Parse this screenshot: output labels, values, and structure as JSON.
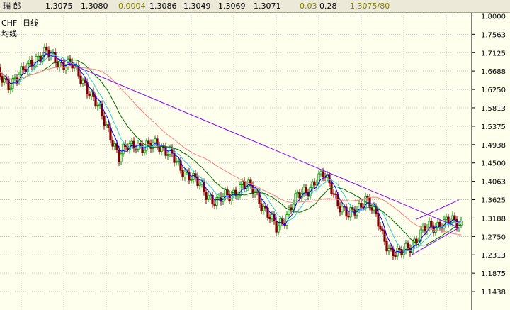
{
  "header": {
    "symbol": "瑞 郎",
    "open": "1.3075",
    "ask": "1.3080",
    "spread": "0.0004",
    "high": "1.3086",
    "low": "1.3049",
    "prev": "1.3069",
    "last": "1.3071",
    "change": "0.03",
    "change_pct": "0.28",
    "bid_ask": "1.3075/80"
  },
  "chart_labels": {
    "instrument": "CHF",
    "period": "日线",
    "indicator": "均线"
  },
  "colors": {
    "background": "#ffffee",
    "grid": "#c8c8c8",
    "candle_up": "#009000",
    "candle_down": "#800000",
    "trendline": "#8000ff",
    "ma_short": "#0000ff",
    "ma_mid": "#33cccc",
    "ma_long": "#006600",
    "ma_xlong": "#ff8080"
  },
  "chart_data": {
    "type": "candlestick",
    "ylim": [
      1.1,
      1.8075
    ],
    "yticks": [
      "1.8000",
      "1.7563",
      "1.7125",
      "1.6688",
      "1.6250",
      "1.5813",
      "1.5375",
      "1.4938",
      "1.4500",
      "1.4063",
      "1.3625",
      "1.3188",
      "1.2750",
      "1.2313",
      "1.1875",
      "1.1438"
    ],
    "grid": true,
    "close_path": [
      [
        0,
        1.66
      ],
      [
        6,
        1.64
      ],
      [
        12,
        1.66
      ],
      [
        18,
        1.7
      ],
      [
        24,
        1.71
      ],
      [
        30,
        1.69
      ],
      [
        36,
        1.68
      ],
      [
        42,
        1.64
      ],
      [
        48,
        1.58
      ],
      [
        54,
        1.52
      ],
      [
        58,
        1.46
      ],
      [
        62,
        1.49
      ],
      [
        66,
        1.5
      ],
      [
        70,
        1.48
      ],
      [
        76,
        1.5
      ],
      [
        82,
        1.47
      ],
      [
        86,
        1.44
      ],
      [
        92,
        1.42
      ],
      [
        98,
        1.38
      ],
      [
        104,
        1.36
      ],
      [
        110,
        1.37
      ],
      [
        116,
        1.4
      ],
      [
        122,
        1.38
      ],
      [
        128,
        1.33
      ],
      [
        132,
        1.29
      ],
      [
        136,
        1.32
      ],
      [
        140,
        1.36
      ],
      [
        146,
        1.38
      ],
      [
        150,
        1.41
      ],
      [
        154,
        1.42
      ],
      [
        158,
        1.39
      ],
      [
        162,
        1.35
      ],
      [
        166,
        1.32
      ],
      [
        170,
        1.34
      ],
      [
        174,
        1.37
      ],
      [
        178,
        1.33
      ],
      [
        182,
        1.28
      ],
      [
        186,
        1.24
      ],
      [
        190,
        1.23
      ],
      [
        194,
        1.25
      ],
      [
        198,
        1.27
      ],
      [
        202,
        1.29
      ],
      [
        206,
        1.3
      ],
      [
        210,
        1.31
      ],
      [
        214,
        1.307
      ]
    ],
    "trendlines": [
      {
        "from": [
          22,
          1.714
        ],
        "to": [
          218,
          1.296
        ]
      },
      {
        "from": [
          196,
          1.232
        ],
        "to": [
          218,
          1.296
        ]
      },
      {
        "from": [
          198,
          1.316
        ],
        "to": [
          218,
          1.362
        ]
      }
    ]
  }
}
